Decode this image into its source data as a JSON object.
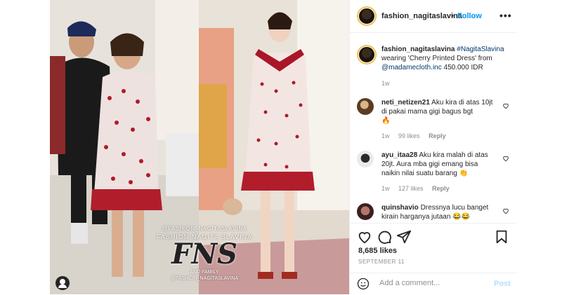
{
  "header": {
    "username": "fashion_nagitaslavina",
    "separator": "•",
    "follow_label": "Follow",
    "more_label": "•••"
  },
  "caption": {
    "username": "fashion_nagitaslavina",
    "hashtag": "#NagitaSlavina",
    "text": "wearing 'Cherry Printed Dress' from",
    "mention": "@madamecloth.inc",
    "price": "450.000 IDR",
    "age": "1w"
  },
  "watermark": {
    "handle": "@FASHION_NAGITASLAVINA",
    "subtitle": "FASHION NAGITA SLAVINA",
    "logo": "FNS",
    "and": "AND FAMILY",
    "handle2": "@FASHION_NAGITASLAVINA"
  },
  "comments": [
    {
      "username": "neti_netizen21",
      "text": "Aku kira di atas 10jt di pakai mama gigi bagus bgt",
      "emoji": "🔥",
      "age": "1w",
      "likes": "99 likes",
      "reply": "Reply"
    },
    {
      "username": "ayu_itaa28",
      "text": "Aku kira malah di atas 20jt. Aura mba gigi emang bisa naikin nilai suatu barang",
      "emoji": "👏",
      "age": "1w",
      "likes": "127 likes",
      "reply": "Reply"
    },
    {
      "username": "quinshavio",
      "text": "Dressnya lucu banget kirain harganya jutaan",
      "emoji": "😂😂",
      "age": "",
      "likes": "",
      "reply": ""
    }
  ],
  "actions": {
    "likes": "8,685 likes",
    "date": "SEPTEMBER 11",
    "comment_placeholder": "Add a comment...",
    "post_label": "Post"
  },
  "colors": {
    "follow": "#0095f6",
    "post_disabled": "#b2dffc",
    "muted": "#8e8e8e",
    "text": "#262626"
  },
  "icons": [
    "heart-icon",
    "comment-icon",
    "share-icon",
    "bookmark-icon",
    "emoji-icon",
    "more-icon",
    "user-tag-icon"
  ]
}
